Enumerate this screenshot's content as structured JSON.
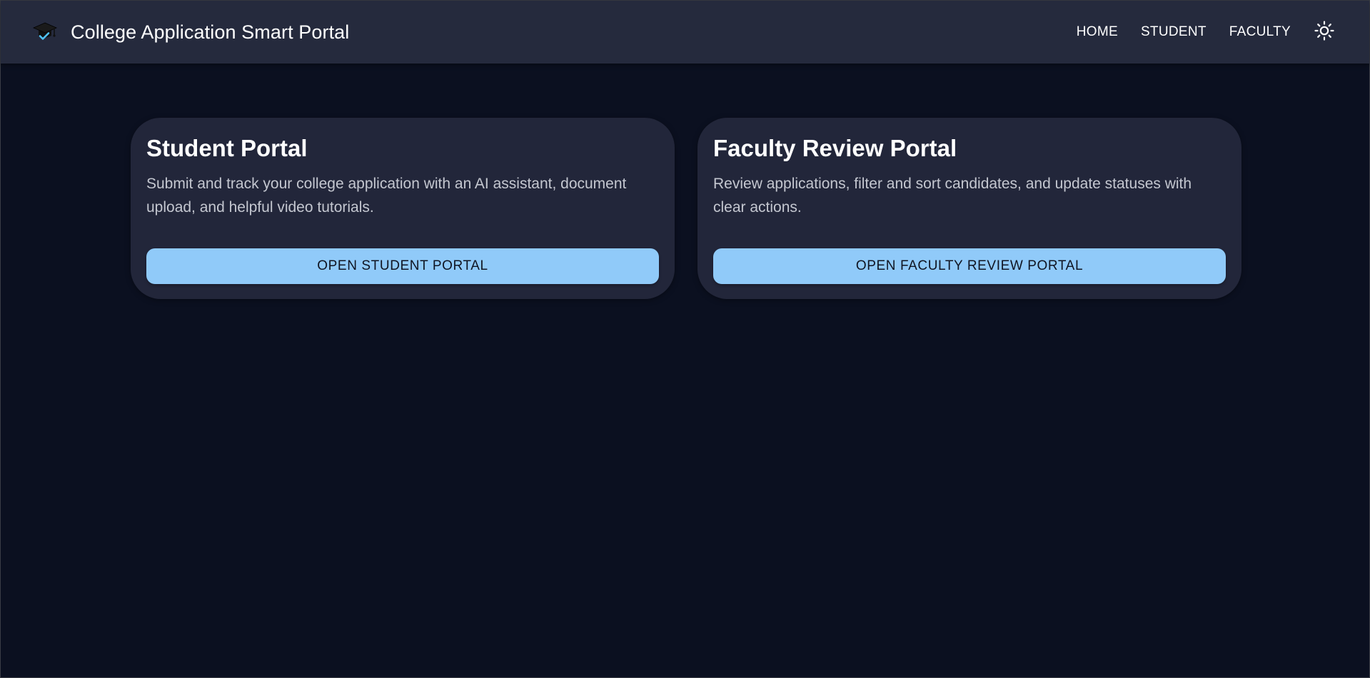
{
  "app": {
    "title": "College Application Smart Portal",
    "logo_icon": "graduation-cap-icon"
  },
  "nav": {
    "items": [
      {
        "label": "HOME"
      },
      {
        "label": "STUDENT"
      },
      {
        "label": "FACULTY"
      }
    ],
    "theme_toggle_icon": "sun-icon"
  },
  "cards": [
    {
      "title": "Student Portal",
      "description": "Submit and track your college application with an AI assistant, document upload, and helpful video tutorials.",
      "button_label": "OPEN STUDENT PORTAL"
    },
    {
      "title": "Faculty Review Portal",
      "description": "Review applications, filter and sort candidates, and update statuses with clear actions.",
      "button_label": "OPEN FACULTY REVIEW PORTAL"
    }
  ],
  "colors": {
    "background": "#0b1020",
    "topbar": "#252a3d",
    "card": "#22263a",
    "accent": "#90caf9"
  }
}
